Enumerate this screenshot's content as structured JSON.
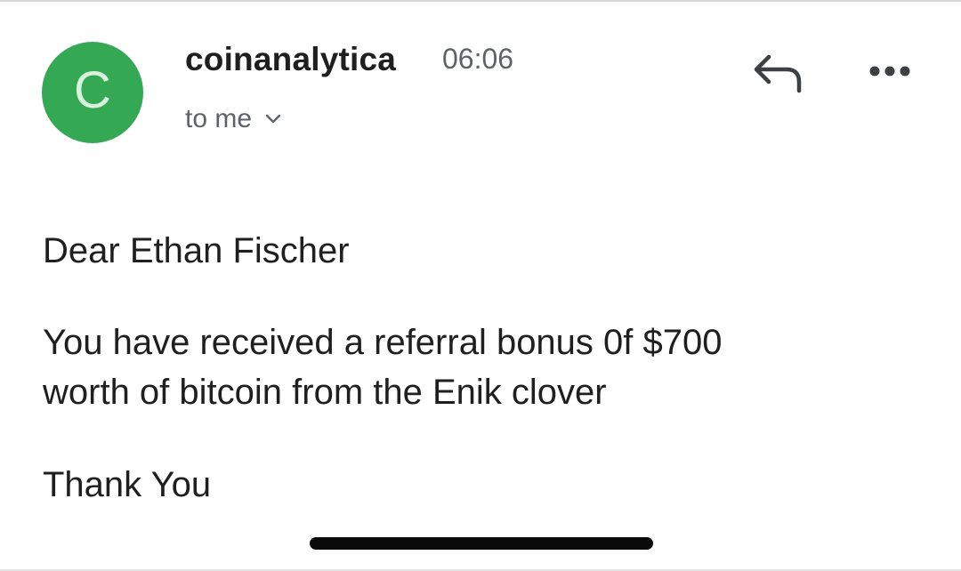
{
  "header": {
    "avatar_letter": "C",
    "sender_name": "coinanalytica",
    "timestamp": "06:06",
    "recipient_label": "to me",
    "avatar_color": "#34a853",
    "reply_icon": "reply-icon",
    "more_icon": "more-options-icon",
    "chevron_icon": "chevron-down-icon"
  },
  "message": {
    "greeting": "Dear Ethan Fischer",
    "body_line_1": "You have received a referral bonus 0f $700",
    "body_line_2": "worth of bitcoin from the Enik clover",
    "signoff": "Thank You"
  }
}
